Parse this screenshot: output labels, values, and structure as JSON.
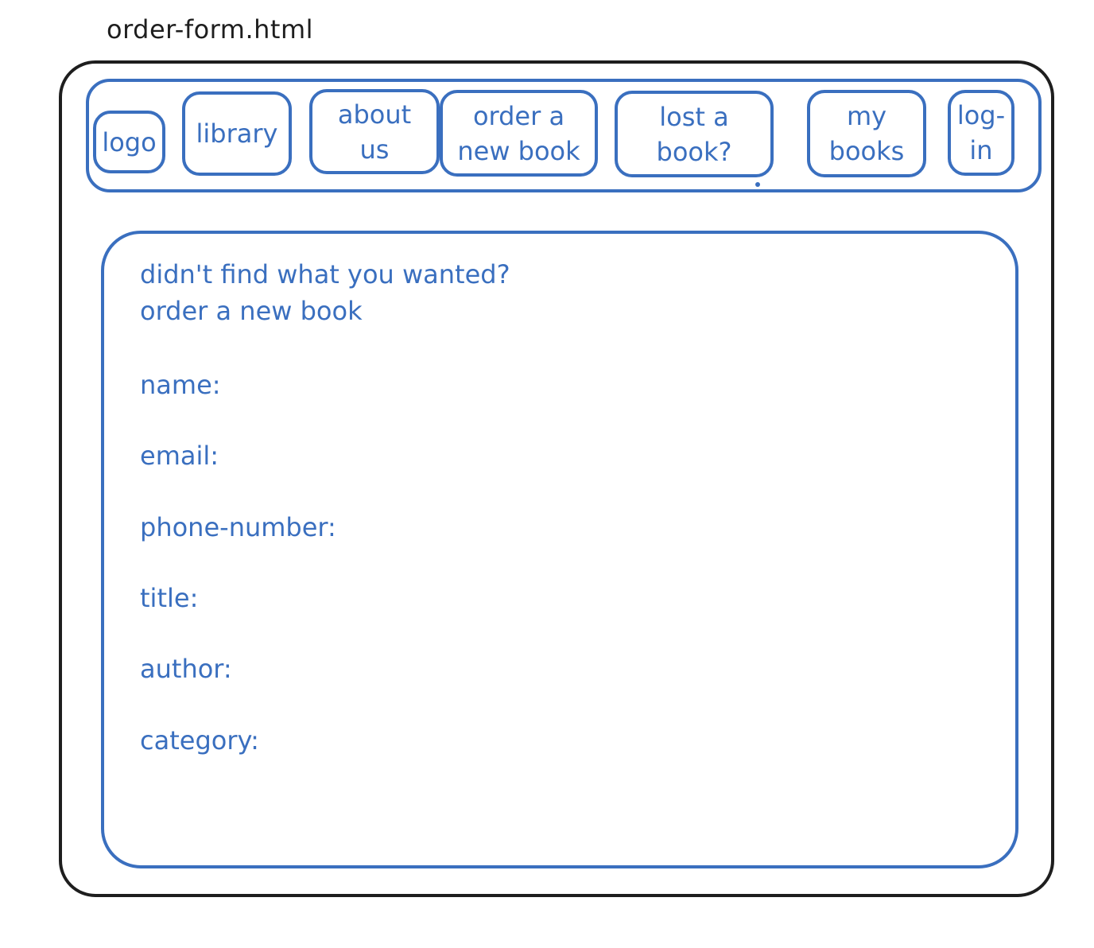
{
  "filename": "order-form.html",
  "nav": {
    "logo": "logo",
    "library": "library",
    "about_us": [
      "about",
      "us"
    ],
    "order_new_book": [
      "order a",
      "new book"
    ],
    "lost_book": [
      "lost a",
      "book?"
    ],
    "my_books": [
      "my",
      "books"
    ],
    "login": [
      "log-",
      "in"
    ]
  },
  "form": {
    "heading_line1": "didn't find what you wanted?",
    "heading_line2": "order a new book",
    "fields": {
      "name": "name:",
      "email": "email:",
      "phone": "phone-number:",
      "title": "title:",
      "author": "author:",
      "category": "category:"
    }
  },
  "colors": {
    "outline": "#1e1e1e",
    "accent": "#3a6fbf"
  }
}
